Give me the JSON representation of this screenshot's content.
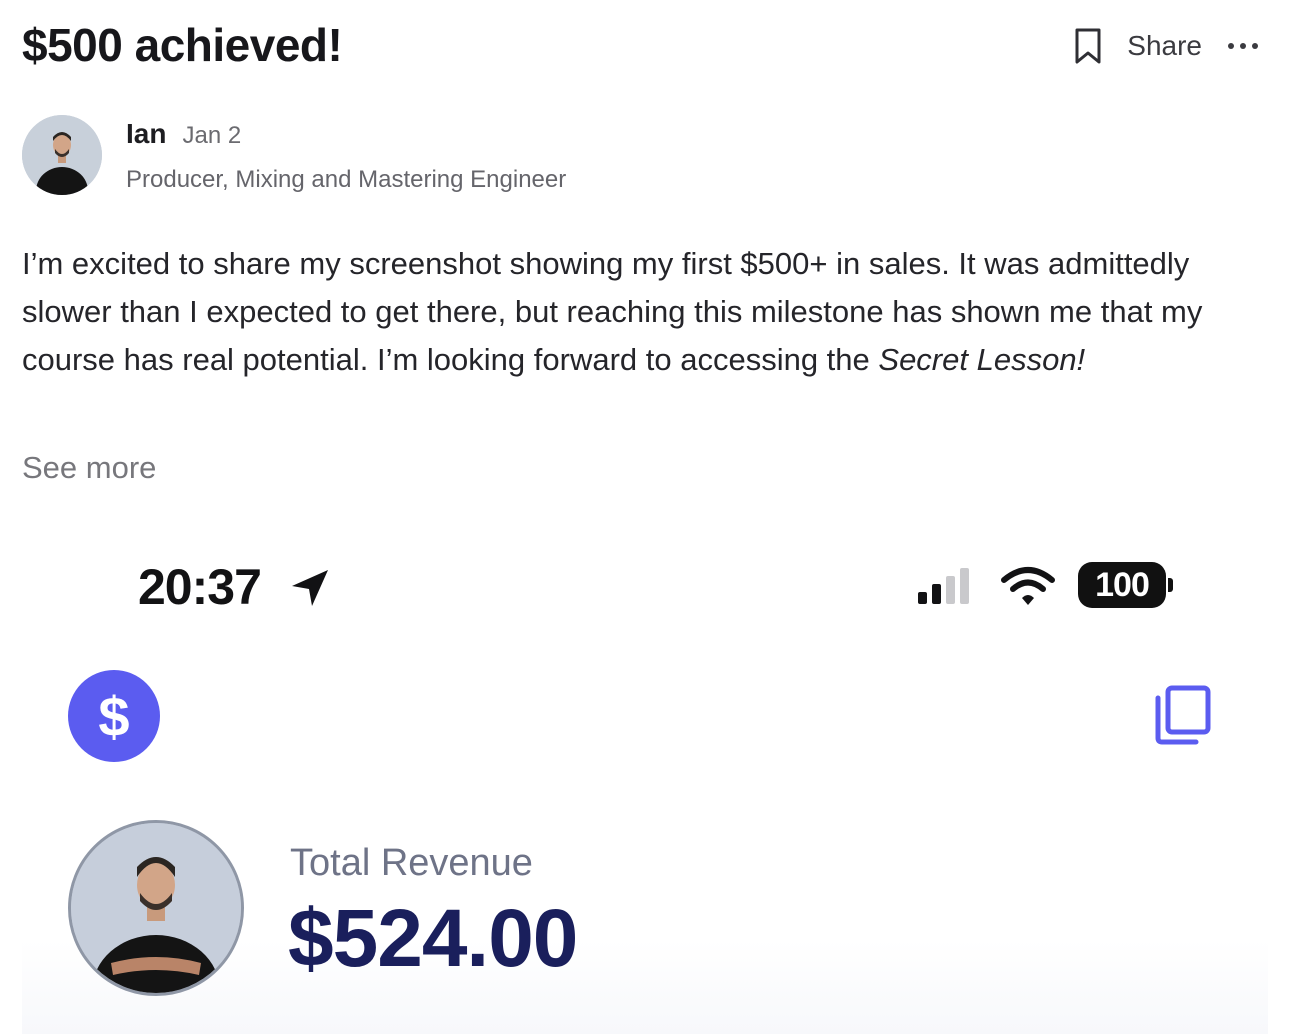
{
  "post": {
    "title": "$500 achieved!",
    "share_label": "Share",
    "author": {
      "name": "Ian",
      "date": "Jan 2",
      "role": "Producer, Mixing and Mastering Engineer"
    },
    "body": {
      "text": "I’m excited to share my screenshot showing my first $500+ in sales. It was admittedly slower than I expected to get there, but reaching this milestone has shown me that my course has real potential. I’m looking forward to accessing the ",
      "emphasis": "Secret Lesson!"
    },
    "see_more": "See more"
  },
  "screenshot": {
    "status_bar": {
      "time": "20:37",
      "battery": "100"
    },
    "app_icon_glyph": "$",
    "revenue": {
      "label": "Total Revenue",
      "value": "$524.00"
    }
  },
  "icons": {
    "bookmark": "bookmark-icon",
    "more": "more-icon",
    "location": "location-arrow-icon",
    "signal": "cellular-signal-icon",
    "wifi": "wifi-icon",
    "copy": "copy-icon"
  },
  "colors": {
    "app_accent": "#5b5cf0",
    "revenue_text": "#1a1f5c",
    "label_gray": "#6e7387"
  }
}
